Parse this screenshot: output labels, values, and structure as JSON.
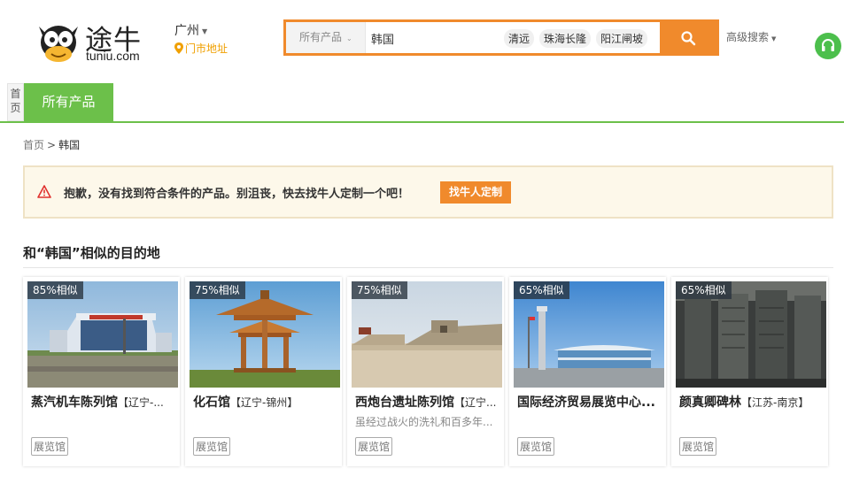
{
  "brand": {
    "name_cn": "途牛",
    "domain": "tuniu.com"
  },
  "location": {
    "city": "广州",
    "store_link": "门市地址"
  },
  "search": {
    "category": "所有产品",
    "value": "韩国",
    "hot_tags": [
      "清远",
      "珠海长隆",
      "阳江闸坡"
    ],
    "advanced_label": "高级搜索"
  },
  "nav": {
    "home": "首页",
    "all_products": "所有产品"
  },
  "breadcrumb": {
    "home": "首页",
    "separator": ">",
    "current": "韩国"
  },
  "notice": {
    "text": "抱歉，没有找到符合条件的产品。别沮丧，快去找牛人定制一个吧！",
    "button": "找牛人定制"
  },
  "similar": {
    "title": "和“韩国”相似的目的地",
    "cards": [
      {
        "similarity": "85%相似",
        "name": "蒸汽机车陈列馆",
        "region": "【辽宁-...",
        "desc": "",
        "tag": "展览馆"
      },
      {
        "similarity": "75%相似",
        "name": "化石馆",
        "region": "【辽宁-锦州】",
        "desc": "",
        "tag": "展览馆"
      },
      {
        "similarity": "75%相似",
        "name": "西炮台遗址陈列馆",
        "region": "【辽宁...",
        "desc": "虽经过战火的洗礼和百多年...",
        "tag": "展览馆"
      },
      {
        "similarity": "65%相似",
        "name": "国际经济贸易展览中心...",
        "region": "",
        "desc": "",
        "tag": "展览馆"
      },
      {
        "similarity": "65%相似",
        "name": "颜真卿碑林",
        "region": "【江苏-南京】",
        "desc": "",
        "tag": "展览馆"
      }
    ]
  },
  "colors": {
    "accent_orange": "#f08a2c",
    "brand_green": "#6cc04a",
    "store_yellow": "#f0a000"
  }
}
